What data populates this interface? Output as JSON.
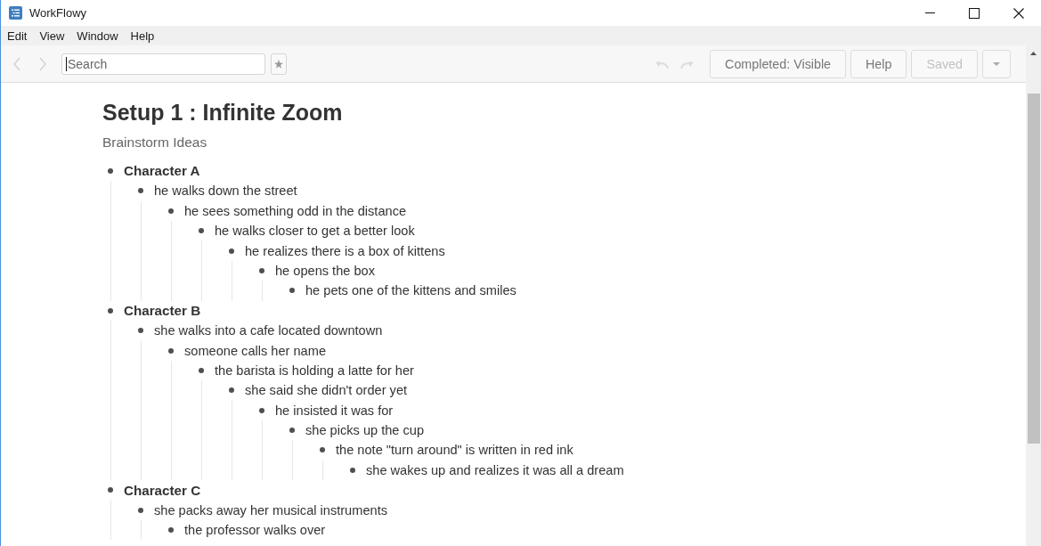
{
  "window": {
    "title": "WorkFlowy"
  },
  "menu": [
    "Edit",
    "View",
    "Window",
    "Help"
  ],
  "toolbar": {
    "nav": [
      {
        "kind": "back",
        "disabled": true
      },
      {
        "kind": "forward",
        "disabled": true
      }
    ],
    "search": {
      "placeholder": "Search",
      "focused": true
    },
    "history": [
      {
        "kind": "undo",
        "disabled": true
      },
      {
        "kind": "redo",
        "disabled": true
      }
    ],
    "buttons": [
      {
        "kind": "text",
        "label": "Completed: Visible",
        "disabled": false
      },
      {
        "kind": "text",
        "label": "Help",
        "disabled": false
      },
      {
        "kind": "text",
        "label": "Saved",
        "disabled": true
      },
      {
        "kind": "menu",
        "disabled": false
      }
    ]
  },
  "document": {
    "title": "Setup 1 : Infinite Zoom",
    "note": "Brainstorm Ideas",
    "items": [
      {
        "text": "Character A",
        "children": [
          {
            "text": "he walks down the street",
            "children": [
              {
                "text": "he sees something odd in the distance",
                "children": [
                  {
                    "text": "he walks closer to get a better look",
                    "children": [
                      {
                        "text": "he realizes there is a box of kittens",
                        "children": [
                          {
                            "text": "he opens the box",
                            "children": [
                              {
                                "text": "he pets one of the kittens and smiles"
                              }
                            ]
                          }
                        ]
                      }
                    ]
                  }
                ]
              }
            ]
          }
        ]
      },
      {
        "text": "Character B",
        "children": [
          {
            "text": "she walks into a cafe located downtown",
            "children": [
              {
                "text": "someone calls her name",
                "children": [
                  {
                    "text": "the barista is holding a latte for her",
                    "children": [
                      {
                        "text": "she said she didn't order yet",
                        "children": [
                          {
                            "text": "he insisted it was for",
                            "children": [
                              {
                                "text": "she picks up the cup",
                                "children": [
                                  {
                                    "text": "the note \"turn around\" is written in red ink",
                                    "children": [
                                      {
                                        "text": "she wakes up and realizes it was all a dream"
                                      }
                                    ]
                                  }
                                ]
                              }
                            ]
                          }
                        ]
                      }
                    ]
                  }
                ]
              }
            ]
          }
        ]
      },
      {
        "text": "Character C",
        "children": [
          {
            "text": "she packs away her musical instruments",
            "children": [
              {
                "text": "the professor walks over"
              }
            ]
          }
        ]
      }
    ]
  }
}
